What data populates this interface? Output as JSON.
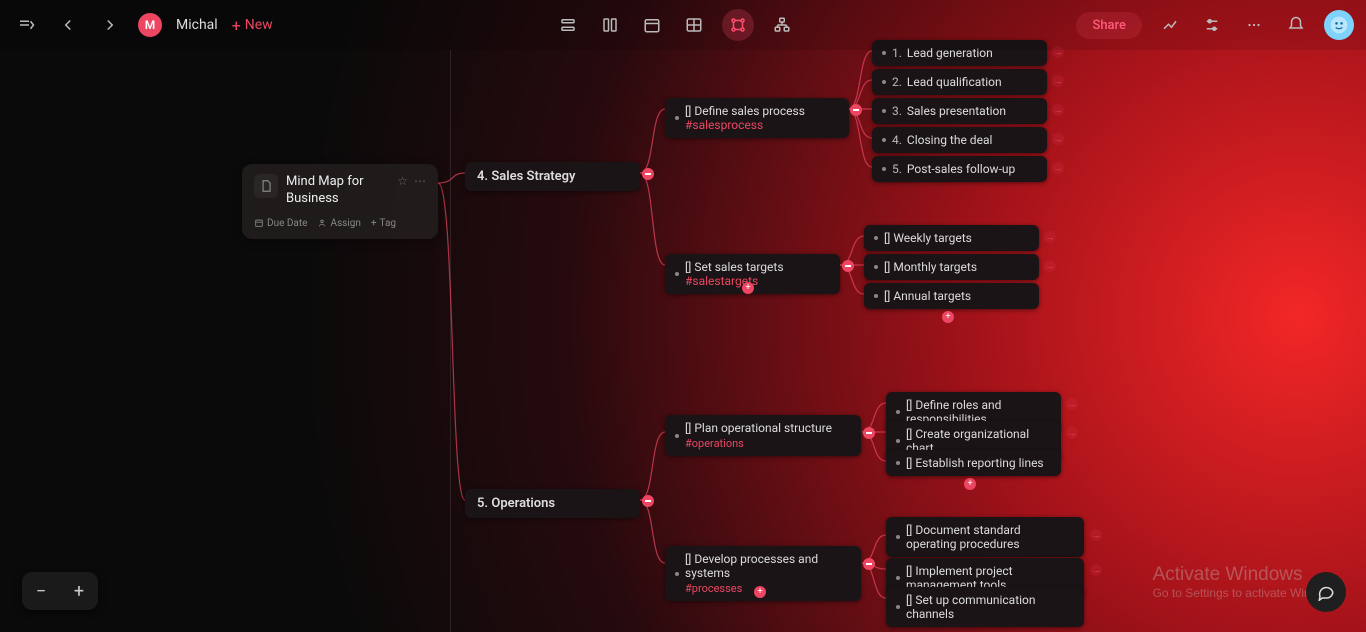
{
  "topbar": {
    "user_initial": "M",
    "username": "Michal",
    "new_label": "New",
    "share_label": "Share"
  },
  "root": {
    "title": "Mind Map for Business",
    "due_date_label": "Due Date",
    "assign_label": "Assign",
    "tag_label": "Tag"
  },
  "level1": {
    "sales_strategy": "4. Sales Strategy",
    "operations": "5. Operations"
  },
  "sales": {
    "define_process": "[] Define sales process",
    "define_process_tag": "#salesprocess",
    "set_targets": "[] Set sales targets",
    "set_targets_tag": "#salestargets",
    "steps": {
      "1": "Lead generation",
      "2": "Lead qualification",
      "3": "Sales presentation",
      "4": "Closing the deal",
      "5": "Post-sales follow-up"
    },
    "targets": {
      "weekly": "[] Weekly targets",
      "monthly": "[] Monthly targets",
      "annual": "[] Annual targets"
    }
  },
  "ops": {
    "plan_structure": "[] Plan operational structure",
    "plan_structure_tag": "#operations",
    "develop_processes": "[] Develop processes and systems",
    "develop_processes_tag": "#processes",
    "structure_items": {
      "roles": "[] Define roles and responsibilities",
      "org_chart": "[] Create organizational chart",
      "reporting": "[] Establish reporting lines"
    },
    "process_items": {
      "sop": "[] Document standard operating procedures",
      "pm_tools": "[] Implement project management tools",
      "comm": "[] Set up communication channels"
    }
  },
  "watermark": {
    "line1": "Activate Windows",
    "line2": "Go to Settings to activate Windows."
  }
}
